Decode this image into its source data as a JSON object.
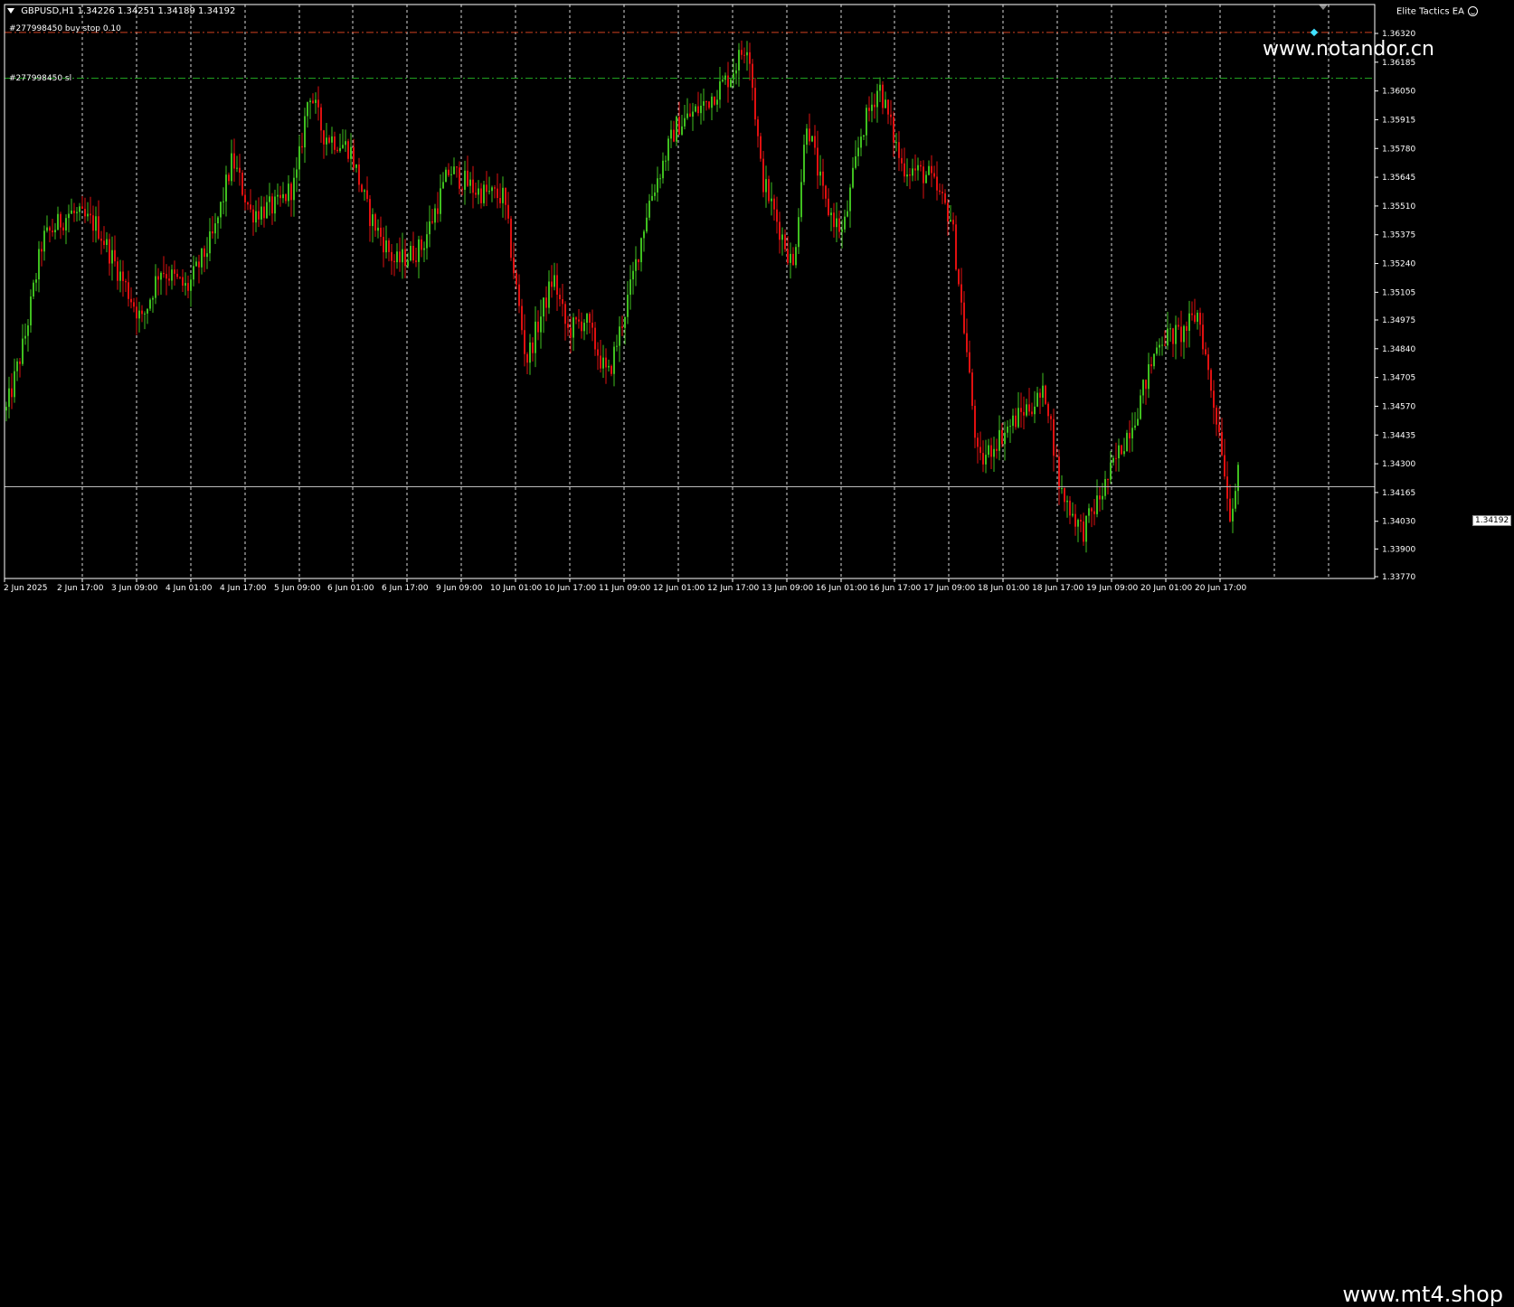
{
  "header": {
    "symbol_label": "GBPUSD,H1",
    "ohlc": "1.34226 1.34251 1.34189 1.34192"
  },
  "ea": {
    "label": "Elite Tactics EA",
    "icon": "smiley-icon"
  },
  "orders": {
    "buy_stop_label": "#277998450 buy stop 0.10",
    "sl_label": "#277998450 sl"
  },
  "watermarks": {
    "top": "www.notandor.cn",
    "bottom": "www.mt4.shop"
  },
  "current_price": "1.34192",
  "colors": {
    "background": "#000000",
    "bull": "#3fbf1f",
    "bear": "#e01010",
    "grid": "#ffffff",
    "buy_stop_line": "#d04020",
    "sl_line": "#20a020",
    "axis_text": "#ffffff"
  },
  "chart_data": {
    "type": "candlestick",
    "symbol": "GBPUSD",
    "timeframe": "H1",
    "price_ticks": [
      "1.36320",
      "1.36185",
      "1.36050",
      "1.35915",
      "1.35780",
      "1.35645",
      "1.35510",
      "1.35375",
      "1.35240",
      "1.35105",
      "1.34975",
      "1.34840",
      "1.34705",
      "1.34570",
      "1.34435",
      "1.34300",
      "1.34165",
      "1.34030",
      "1.33900",
      "1.33770"
    ],
    "price_tick_values": [
      1.3632,
      1.36185,
      1.3605,
      1.35915,
      1.3578,
      1.35645,
      1.3551,
      1.35375,
      1.3524,
      1.35105,
      1.34975,
      1.3484,
      1.34705,
      1.3457,
      1.34435,
      1.343,
      1.34165,
      1.3403,
      1.339,
      1.3377
    ],
    "time_ticks": [
      "2 Jun 2025",
      "2 Jun 17:00",
      "3 Jun 09:00",
      "4 Jun 01:00",
      "4 Jun 17:00",
      "5 Jun 09:00",
      "6 Jun 01:00",
      "6 Jun 17:00",
      "9 Jun 09:00",
      "10 Jun 01:00",
      "10 Jun 17:00",
      "11 Jun 09:00",
      "12 Jun 01:00",
      "12 Jun 17:00",
      "13 Jun 09:00",
      "16 Jun 01:00",
      "16 Jun 17:00",
      "17 Jun 09:00",
      "18 Jun 01:00",
      "18 Jun 17:00",
      "19 Jun 09:00",
      "20 Jun 01:00",
      "20 Jun 17:00"
    ],
    "buy_stop_price": 1.36325,
    "sl_price": 1.3611,
    "current_price": 1.34192,
    "path": [
      [
        0,
        1.3455
      ],
      [
        20,
        1.3488
      ],
      [
        40,
        1.3535
      ],
      [
        70,
        1.3548
      ],
      [
        100,
        1.3542
      ],
      [
        130,
        1.3515
      ],
      [
        150,
        1.3497
      ],
      [
        170,
        1.3522
      ],
      [
        200,
        1.3512
      ],
      [
        230,
        1.3538
      ],
      [
        250,
        1.3573
      ],
      [
        270,
        1.3548
      ],
      [
        300,
        1.3551
      ],
      [
        320,
        1.3562
      ],
      [
        335,
        1.3606
      ],
      [
        350,
        1.3585
      ],
      [
        380,
        1.3578
      ],
      [
        400,
        1.3548
      ],
      [
        430,
        1.3524
      ],
      [
        460,
        1.3532
      ],
      [
        490,
        1.3568
      ],
      [
        520,
        1.3558
      ],
      [
        550,
        1.3555
      ],
      [
        575,
        1.3478
      ],
      [
        605,
        1.3518
      ],
      [
        620,
        1.3492
      ],
      [
        640,
        1.3498
      ],
      [
        665,
        1.347
      ],
      [
        690,
        1.3512
      ],
      [
        710,
        1.3552
      ],
      [
        740,
        1.3588
      ],
      [
        770,
        1.3598
      ],
      [
        800,
        1.3612
      ],
      [
        820,
        1.3629
      ],
      [
        835,
        1.3565
      ],
      [
        870,
        1.3522
      ],
      [
        885,
        1.3592
      ],
      [
        905,
        1.3552
      ],
      [
        925,
        1.3538
      ],
      [
        945,
        1.3585
      ],
      [
        965,
        1.3608
      ],
      [
        990,
        1.357
      ],
      [
        1020,
        1.3565
      ],
      [
        1045,
        1.3545
      ],
      [
        1060,
        1.349
      ],
      [
        1075,
        1.3429
      ],
      [
        1095,
        1.3441
      ],
      [
        1125,
        1.3455
      ],
      [
        1150,
        1.3463
      ],
      [
        1165,
        1.3418
      ],
      [
        1190,
        1.3398
      ],
      [
        1210,
        1.3415
      ],
      [
        1230,
        1.3435
      ],
      [
        1250,
        1.3455
      ],
      [
        1275,
        1.3489
      ],
      [
        1300,
        1.3491
      ],
      [
        1318,
        1.3501
      ],
      [
        1330,
        1.347
      ],
      [
        1345,
        1.3436
      ],
      [
        1352,
        1.3406
      ],
      [
        1362,
        1.3424
      ]
    ]
  }
}
